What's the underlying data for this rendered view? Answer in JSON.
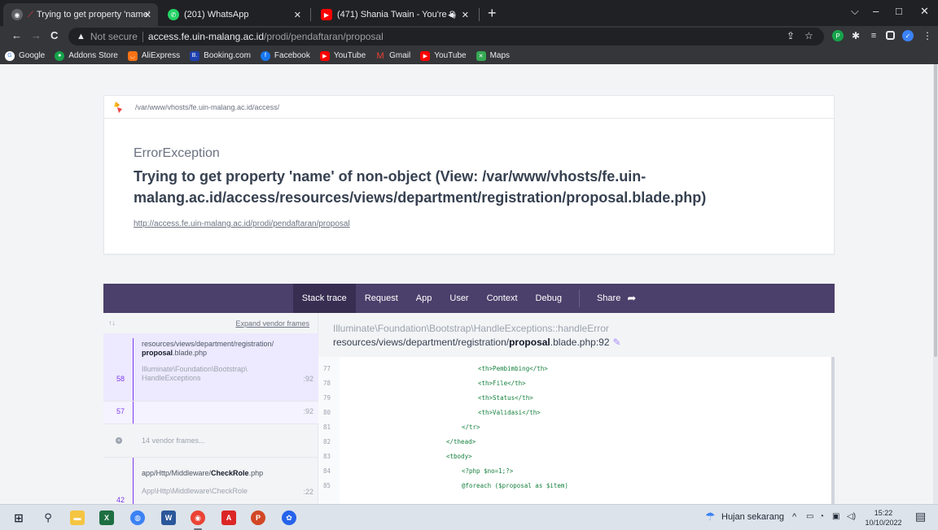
{
  "browser": {
    "tabs": [
      {
        "label": "Trying to get property 'name'",
        "active": true
      },
      {
        "label": "(201) WhatsApp",
        "active": false
      },
      {
        "label": "(471) Shania Twain - You're S",
        "active": false
      }
    ],
    "new_tab": "+",
    "window_controls": {
      "minimize": "–",
      "maximize": "□",
      "close": "✕",
      "search_tabs": "⌵"
    },
    "nav": {
      "back": "←",
      "forward": "→",
      "reload": "C"
    },
    "address": {
      "security_label": "Not secure",
      "host": "access.fe.uin-malang.ac.id",
      "path": "/prodi/pendaftaran/proposal"
    },
    "bookmarks": [
      "Google",
      "Addons Store",
      "AliExpress",
      "Booking.com",
      "Facebook",
      "YouTube",
      "Gmail",
      "YouTube",
      "Maps"
    ]
  },
  "error_page": {
    "path_header": "/var/www/vhosts/fe.uin-malang.ac.id/access/",
    "exception_class": "ErrorException",
    "exception_message": "Trying to get property 'name' of non-object (View: /var/www/vhosts/fe.uin-malang.ac.id/access/resources/views/department/registration/proposal.blade.php)",
    "url": "http://access.fe.uin-malang.ac.id/prodi/pendaftaran/proposal",
    "tabs": [
      "Stack trace",
      "Request",
      "App",
      "User",
      "Context",
      "Debug"
    ],
    "share_label": "Share",
    "stack": {
      "sort_arrows": "↑↓",
      "expand_label": "Expand vendor frames",
      "frames": [
        {
          "number": "58",
          "file_prefix": "resources/views/department/registration/",
          "file_bold": "proposal",
          "file_suffix": ".blade.php",
          "class_line1": "Illuminate\\Foundation\\Bootstrap\\",
          "class_line2": "HandleExceptions",
          "line": ":92"
        },
        {
          "number": "57",
          "line": ":92"
        },
        {
          "vendor_label": "14 vendor frames..."
        },
        {
          "number": "42",
          "file_prefix": "app/Http/Middleware/",
          "file_bold": "CheckRole",
          "file_suffix": ".php",
          "class_line1": "App\\Http\\Middleware\\CheckRole",
          "line": ":22"
        }
      ]
    },
    "code": {
      "class_path": "Illuminate\\Foundation\\Bootstrap\\HandleExceptions::handleError",
      "file_prefix": "resources/views/department/registration/",
      "file_bold": "proposal",
      "file_suffix": ".blade.php:92",
      "lines": [
        {
          "n": "77",
          "text": "<th>Pembimbing</th>"
        },
        {
          "n": "78",
          "text": "<th>File</th>"
        },
        {
          "n": "79",
          "text": "<th>Status</th>"
        },
        {
          "n": "80",
          "text": "<th>Validasi</th>"
        },
        {
          "n": "81",
          "text": "</tr>"
        },
        {
          "n": "82",
          "text": "</thead>"
        },
        {
          "n": "83",
          "text": "<tbody>"
        },
        {
          "n": "84",
          "text": "<?php $no=1;?>"
        },
        {
          "n": "85",
          "text": "@foreach ($proposal as $item)"
        }
      ]
    }
  },
  "taskbar": {
    "weather": "Hujan sekarang",
    "time": "15:22",
    "date": "10/10/2022"
  },
  "colors": {
    "nav_strip": "#4b3f6b",
    "accent": "#7c3aed",
    "code_green": "#15803d"
  }
}
